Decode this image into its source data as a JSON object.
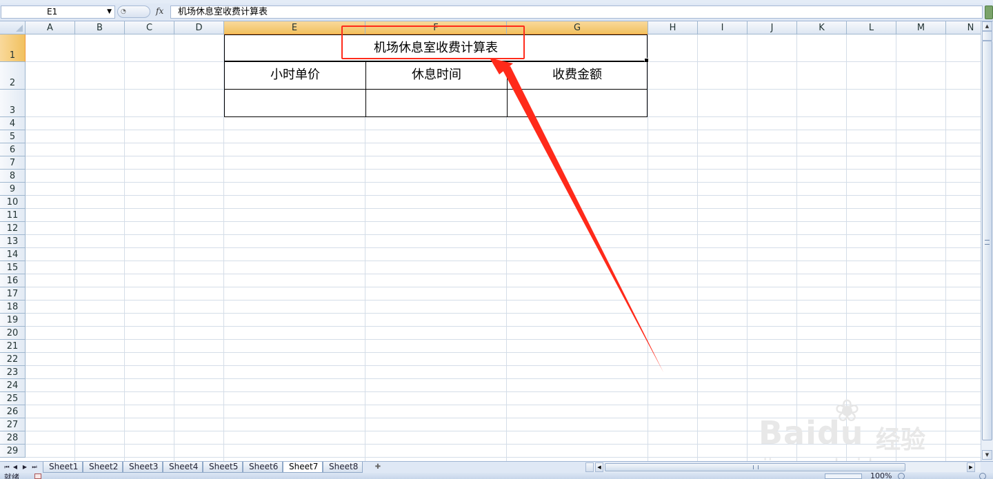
{
  "formula_bar": {
    "name_box": "E1",
    "fx_label": "fx",
    "content": "机场休息室收费计算表"
  },
  "columns": [
    "A",
    "B",
    "C",
    "D",
    "E",
    "F",
    "G",
    "H",
    "I",
    "J",
    "K",
    "L",
    "M",
    "N"
  ],
  "selected_columns": [
    "E",
    "F",
    "G"
  ],
  "rows": [
    "1",
    "2",
    "3",
    "4",
    "5",
    "6",
    "7",
    "8",
    "9",
    "10",
    "11",
    "12",
    "13",
    "14",
    "15",
    "16",
    "17",
    "18",
    "19",
    "20",
    "21",
    "22",
    "23",
    "24",
    "25",
    "26",
    "27",
    "28",
    "29"
  ],
  "selected_rows": [
    "1"
  ],
  "table": {
    "title": "机场休息室收费计算表",
    "headers": [
      "小时单价",
      "休息时间",
      "收费金额"
    ],
    "row3": [
      "",
      "",
      ""
    ]
  },
  "sheet_tabs": [
    "Sheet1",
    "Sheet2",
    "Sheet3",
    "Sheet4",
    "Sheet5",
    "Sheet6",
    "Sheet7",
    "Sheet8"
  ],
  "active_sheet": "Sheet7",
  "status": {
    "ready": "就绪",
    "zoom": "100%"
  },
  "watermark": {
    "brand": "Baidu",
    "cn": "经验",
    "url": "jingyan.baidu.com"
  },
  "annotation_color": "#ff2a1a",
  "selection_color": "#f1c15f",
  "icons": [
    "dropdown-arrow-icon",
    "expand-formula-icon",
    "fx-icon",
    "scroll-up-icon",
    "scroll-down-icon",
    "tab-first-icon",
    "tab-prev-icon",
    "tab-next-icon",
    "tab-last-icon",
    "new-sheet-icon",
    "scroll-left-icon",
    "scroll-right-icon",
    "macro-record-icon"
  ]
}
